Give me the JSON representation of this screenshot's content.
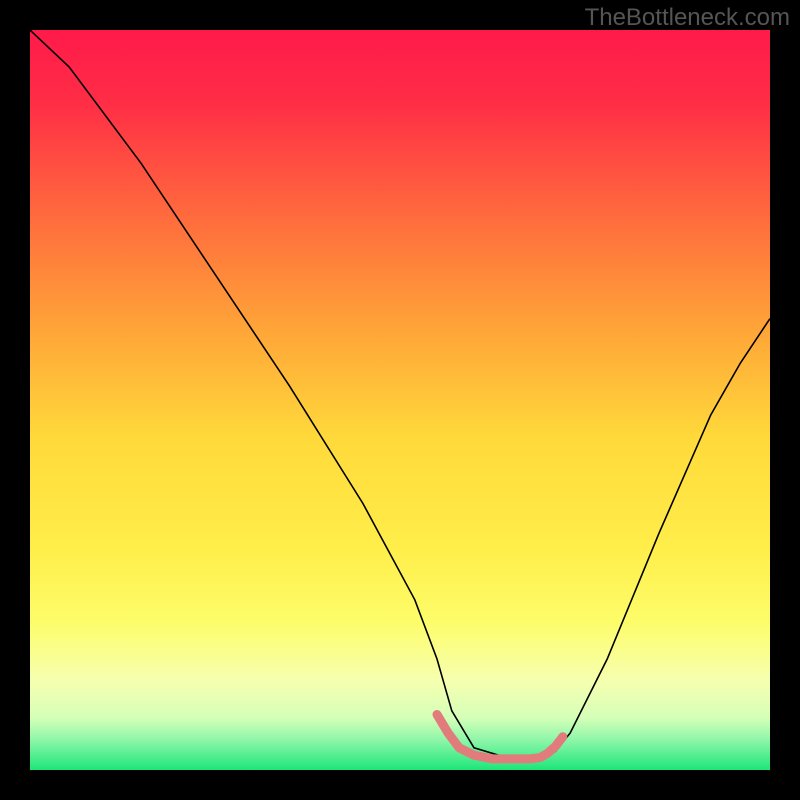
{
  "watermark": "TheBottleneck.com",
  "chart_data": {
    "type": "line",
    "title": "",
    "xlabel": "",
    "ylabel": "",
    "xlim": [
      0,
      100
    ],
    "ylim": [
      0,
      100
    ],
    "background_gradient": {
      "stops": [
        {
          "offset": 0,
          "color": "#ff1a4a"
        },
        {
          "offset": 0.1,
          "color": "#ff2e46"
        },
        {
          "offset": 0.25,
          "color": "#ff6a3d"
        },
        {
          "offset": 0.4,
          "color": "#ffa338"
        },
        {
          "offset": 0.55,
          "color": "#ffd93a"
        },
        {
          "offset": 0.7,
          "color": "#ffee4a"
        },
        {
          "offset": 0.8,
          "color": "#fdfd6a"
        },
        {
          "offset": 0.88,
          "color": "#f6ffb0"
        },
        {
          "offset": 0.93,
          "color": "#d4ffb8"
        },
        {
          "offset": 0.96,
          "color": "#8cf6a8"
        },
        {
          "offset": 1.0,
          "color": "#1de67a"
        }
      ]
    },
    "series": [
      {
        "name": "bottleneck-curve",
        "color": "#000000",
        "stroke_width": 1.6,
        "x": [
          0.0,
          5.3,
          15.0,
          25.0,
          35.0,
          45.0,
          52.0,
          55.0,
          57.0,
          60.0,
          65.0,
          69.0,
          71.0,
          73.0,
          78.0,
          85.0,
          92.0,
          96.0,
          100.0
        ],
        "values": [
          100.0,
          95.0,
          82.0,
          67.0,
          52.0,
          36.0,
          23.0,
          15.0,
          8.0,
          3.0,
          1.5,
          1.5,
          2.5,
          5.0,
          15.0,
          32.0,
          48.0,
          55.0,
          61.0
        ]
      }
    ],
    "highlight": {
      "name": "optimal-range-marker",
      "color": "#e27c7c",
      "stroke_width": 9,
      "x": [
        55.0,
        56.5,
        58.0,
        60.0,
        62.5,
        65.0,
        67.5,
        69.0,
        70.0,
        71.0,
        72.0
      ],
      "values": [
        7.5,
        5.0,
        3.0,
        2.0,
        1.5,
        1.5,
        1.5,
        1.7,
        2.3,
        3.2,
        4.5
      ]
    }
  }
}
